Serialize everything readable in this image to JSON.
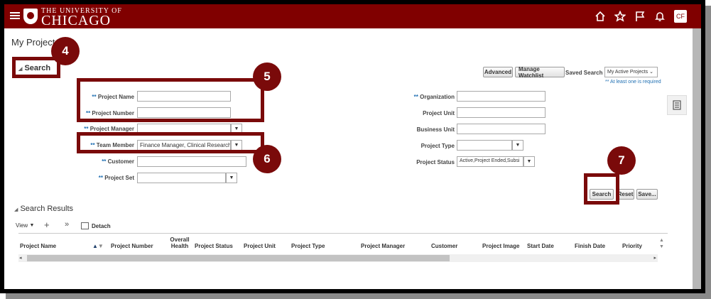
{
  "header": {
    "brand_line1": "THE UNIVERSITY OF",
    "brand_line2": "CHICAGO",
    "avatar": "CF"
  },
  "page_title": "My Projects",
  "search_section": {
    "label": "Search",
    "advanced": "Advanced",
    "manage_watchlist": "Manage Watchlist",
    "saved_search_label": "Saved Search",
    "saved_search_value": "My Active Projects",
    "at_least_one": "** At least one is required",
    "req_marker": "**",
    "fields": {
      "project_name": {
        "label": "Project Name",
        "value": ""
      },
      "project_number": {
        "label": "Project Number",
        "value": ""
      },
      "project_manager": {
        "label": "Project Manager",
        "value": ""
      },
      "team_member": {
        "label": "Team Member",
        "value": "Finance Manager, Clinical Research"
      },
      "customer": {
        "label": "Customer",
        "value": ""
      },
      "project_set": {
        "label": "Project Set",
        "value": ""
      },
      "organization": {
        "label": "Organization",
        "value": ""
      },
      "project_unit": {
        "label": "Project Unit",
        "value": ""
      },
      "business_unit": {
        "label": "Business Unit",
        "value": ""
      },
      "project_type": {
        "label": "Project Type",
        "value": ""
      },
      "project_status": {
        "label": "Project Status",
        "value": "Active,Project Ended,Subsi"
      }
    },
    "search_btn": "Search",
    "reset_btn": "Reset",
    "save_btn": "Save..."
  },
  "results": {
    "label": "Search Results",
    "view": "View",
    "add": "+",
    "more": "»",
    "detach": "Detach",
    "columns": [
      "Project Name",
      "Project Number",
      "Overall Health",
      "Project Status",
      "Project Unit",
      "Project Type",
      "Project Manager",
      "Customer",
      "Project Image",
      "Start Date",
      "Finish Date",
      "Priority"
    ]
  },
  "callouts": [
    "4",
    "5",
    "6",
    "7"
  ],
  "colors": {
    "brand": "#800000",
    "callout": "#7a0a0a",
    "required": "#1f6fb2"
  }
}
